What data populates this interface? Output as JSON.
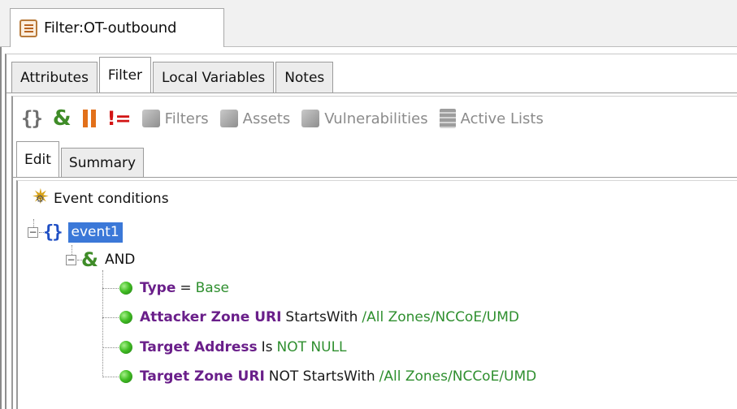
{
  "window": {
    "title": "Filter:OT-outbound",
    "icon": "document-list-icon"
  },
  "main_tabs": [
    {
      "label": "Attributes",
      "active": false
    },
    {
      "label": "Filter",
      "active": true
    },
    {
      "label": "Local Variables",
      "active": false
    },
    {
      "label": "Notes",
      "active": false
    }
  ],
  "toolbar": {
    "event_button_icon": "braces-icon",
    "and_button_icon": "ampersand-icon",
    "or_button_icon": "double-bar-icon",
    "not_button_icon": "not-equal-icon",
    "filters_label": "Filters",
    "assets_label": "Assets",
    "vulnerabilities_label": "Vulnerabilities",
    "active_lists_label": "Active Lists"
  },
  "sub_tabs": [
    {
      "label": "Edit",
      "active": true
    },
    {
      "label": "Summary",
      "active": false
    }
  ],
  "tree": {
    "root_label": "Event conditions",
    "event_label": "event1",
    "group_label": "AND",
    "conditions": [
      {
        "field": "Type",
        "operator": "=",
        "value": "Base"
      },
      {
        "field": "Attacker Zone URI",
        "operator": "StartsWith",
        "value": "/All Zones/NCCoE/UMD"
      },
      {
        "field": "Target Address",
        "operator": "Is",
        "value": "NOT NULL"
      },
      {
        "field": "Target Zone URI",
        "operator": "NOT StartsWith",
        "value": "/All Zones/NCCoE/UMD"
      }
    ]
  },
  "colors": {
    "selection": "#3b78d8",
    "field_text": "#6a1f8a",
    "value_text": "#2f8f2f",
    "and_icon": "#3f8c28",
    "or_icon": "#e2701a",
    "not_icon": "#d21414",
    "event_brace": "#1f4fc4"
  }
}
